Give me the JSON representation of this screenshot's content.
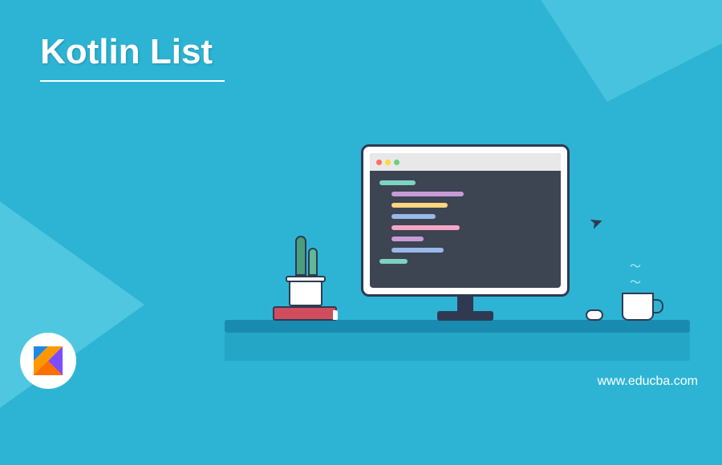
{
  "title": "Kotlin List",
  "website": "www.educba.com",
  "logo_name": "kotlin"
}
